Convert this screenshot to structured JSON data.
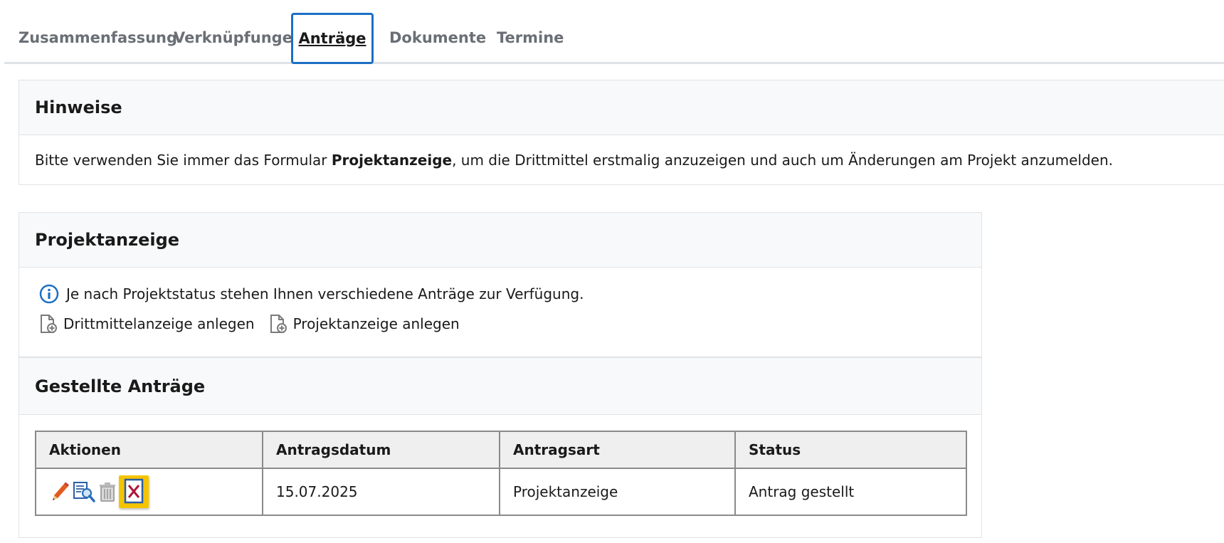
{
  "tabs": [
    {
      "label": "Zusammenfassung"
    },
    {
      "label": "Verknüpfungen"
    },
    {
      "label": "Anträge"
    },
    {
      "label": "Dokumente"
    },
    {
      "label": "Termine"
    }
  ],
  "hinweise": {
    "title": "Hinweise",
    "text_before": "Bitte verwenden Sie immer das Formular ",
    "text_bold": "Projektanzeige",
    "text_after": ", um die Drittmittel erstmalig anzuzeigen und auch um Änderungen am Projekt anzumelden."
  },
  "projektanzeige": {
    "title": "Projektanzeige",
    "info_text": "Je nach Projektstatus stehen Ihnen verschiedene Anträge zur Verfügung.",
    "actions": [
      {
        "label": "Drittmittelanzeige anlegen",
        "icon": "new-document-icon"
      },
      {
        "label": "Projektanzeige anlegen",
        "icon": "new-document-icon"
      }
    ]
  },
  "gestellte_antraege": {
    "title": "Gestellte Anträge",
    "columns": [
      "Aktionen",
      "Antragsdatum",
      "Antragsart",
      "Status"
    ],
    "rows": [
      {
        "datum": "15.07.2025",
        "art": "Projektanzeige",
        "status": "Antrag gestellt"
      }
    ]
  },
  "colors": {
    "active_tab_border": "#1c6fc4",
    "highlight": "#f5c400",
    "info_icon": "#1c6fc4"
  }
}
